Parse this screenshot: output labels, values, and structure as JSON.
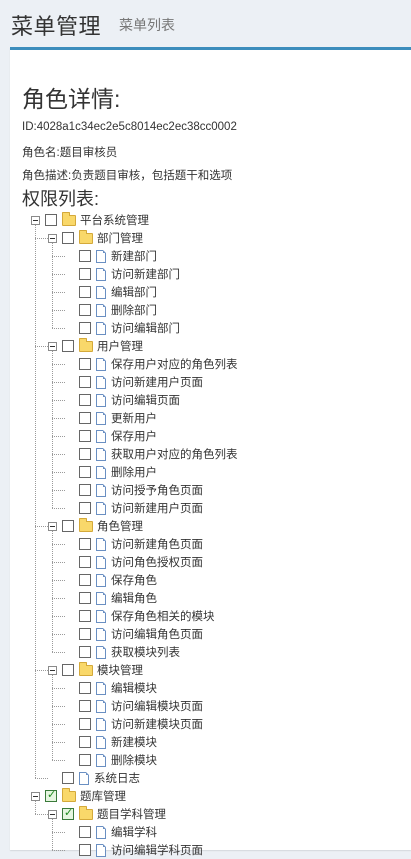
{
  "header": {
    "title": "菜单管理",
    "subtitle": "菜单列表"
  },
  "role": {
    "heading": "角色详情:",
    "id": "ID:4028a1c34ec2e5c8014ec2ec38cc0002",
    "name": "角色名:题目审核员",
    "desc": "角色描述:负责题目审核，包括题干和选项"
  },
  "perm_heading": "权限列表:",
  "tree": [
    {
      "label": "平台系统管理",
      "level": 0,
      "type": "folder",
      "checked": false,
      "expanded": true
    },
    {
      "label": "部门管理",
      "level": 1,
      "type": "folder",
      "checked": false,
      "expanded": true
    },
    {
      "label": "新建部门",
      "level": 2,
      "type": "file",
      "checked": false
    },
    {
      "label": "访问新建部门",
      "level": 2,
      "type": "file",
      "checked": false
    },
    {
      "label": "编辑部门",
      "level": 2,
      "type": "file",
      "checked": false
    },
    {
      "label": "删除部门",
      "level": 2,
      "type": "file",
      "checked": false
    },
    {
      "label": "访问编辑部门",
      "level": 2,
      "type": "file",
      "checked": false
    },
    {
      "label": "用户管理",
      "level": 1,
      "type": "folder",
      "checked": false,
      "expanded": true
    },
    {
      "label": " 保存用户对应的角色列表",
      "level": 2,
      "type": "file",
      "checked": false
    },
    {
      "label": "访问新建用户页面",
      "level": 2,
      "type": "file",
      "checked": false
    },
    {
      "label": " 访问编辑页面",
      "level": 2,
      "type": "file",
      "checked": false
    },
    {
      "label": "更新用户",
      "level": 2,
      "type": "file",
      "checked": false
    },
    {
      "label": "保存用户",
      "level": 2,
      "type": "file",
      "checked": false
    },
    {
      "label": "获取用户对应的角色列表",
      "level": 2,
      "type": "file",
      "checked": false
    },
    {
      "label": " 删除用户",
      "level": 2,
      "type": "file",
      "checked": false
    },
    {
      "label": " 访问授予角色页面",
      "level": 2,
      "type": "file",
      "checked": false
    },
    {
      "label": " 访问新建用户页面",
      "level": 2,
      "type": "file",
      "checked": false
    },
    {
      "label": "角色管理",
      "level": 1,
      "type": "folder",
      "checked": false,
      "expanded": true
    },
    {
      "label": " 访问新建角色页面",
      "level": 2,
      "type": "file",
      "checked": false
    },
    {
      "label": "访问角色授权页面",
      "level": 2,
      "type": "file",
      "checked": false
    },
    {
      "label": "保存角色",
      "level": 2,
      "type": "file",
      "checked": false
    },
    {
      "label": "编辑角色",
      "level": 2,
      "type": "file",
      "checked": false
    },
    {
      "label": "保存角色相关的模块",
      "level": 2,
      "type": "file",
      "checked": false
    },
    {
      "label": "访问编辑角色页面",
      "level": 2,
      "type": "file",
      "checked": false
    },
    {
      "label": "获取模块列表",
      "level": 2,
      "type": "file",
      "checked": false
    },
    {
      "label": "模块管理",
      "level": 1,
      "type": "folder",
      "checked": false,
      "expanded": true
    },
    {
      "label": "编辑模块",
      "level": 2,
      "type": "file",
      "checked": false
    },
    {
      "label": "访问编辑模块页面",
      "level": 2,
      "type": "file",
      "checked": false
    },
    {
      "label": "访问新建模块页面",
      "level": 2,
      "type": "file",
      "checked": false
    },
    {
      "label": "新建模块",
      "level": 2,
      "type": "file",
      "checked": false
    },
    {
      "label": "删除模块",
      "level": 2,
      "type": "file",
      "checked": false
    },
    {
      "label": "系统日志",
      "level": 1,
      "type": "file",
      "checked": false
    },
    {
      "label": "题库管理",
      "level": 0,
      "type": "folder",
      "checked": true,
      "expanded": true
    },
    {
      "label": "题目学科管理",
      "level": 1,
      "type": "folder",
      "checked": true,
      "expanded": true
    },
    {
      "label": "编辑学科",
      "level": 2,
      "type": "file",
      "checked": false
    },
    {
      "label": "访问编辑学科页面",
      "level": 2,
      "type": "file",
      "checked": false
    }
  ]
}
